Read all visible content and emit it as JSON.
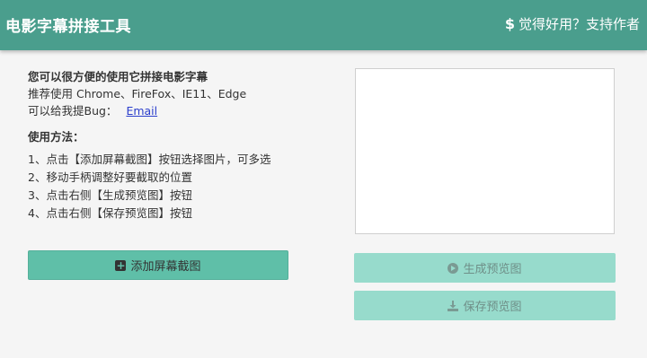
{
  "header": {
    "title": "电影字幕拼接工具",
    "support_label": "觉得好用？支持作者",
    "support_icon": "dollar-icon"
  },
  "instructions": {
    "headline": "您可以很方便的使用它拼接电影字幕",
    "browsers": "推荐使用 Chrome、FireFox、IE11、Edge",
    "bug_text": "可以给我提Bug：",
    "bug_link": "Email",
    "usage_title": "使用方法：",
    "steps": [
      "1、点击【添加屏幕截图】按钮选择图片，可多选",
      "2、移动手柄调整好要截取的位置",
      "3、点击右侧【生成预览图】按钮",
      "4、点击右侧【保存预览图】按钮"
    ]
  },
  "buttons": {
    "add_screenshot": "添加屏幕截图",
    "generate_preview": "生成预览图",
    "save_preview": "保存预览图"
  },
  "colors": {
    "header_bg": "#4a9e8d",
    "primary_button": "#5fbfa8",
    "disabled_button": "#97dbcc",
    "link": "#2a3dcc"
  }
}
